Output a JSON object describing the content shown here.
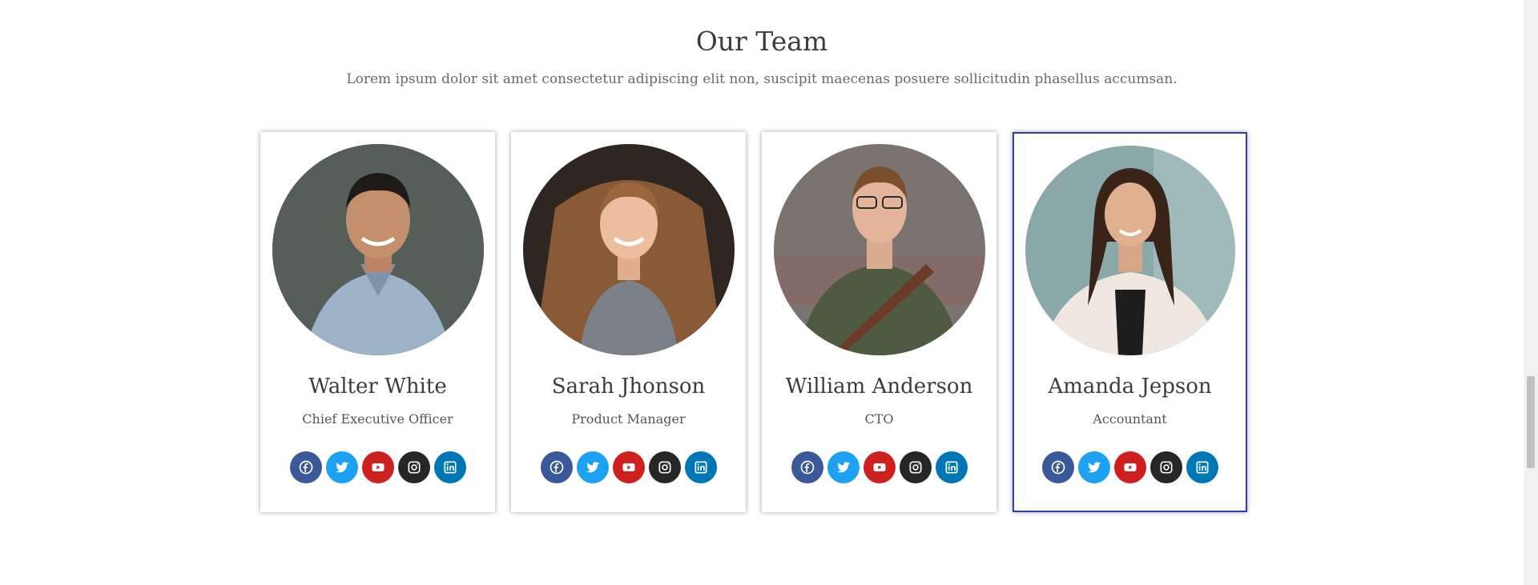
{
  "section": {
    "title": "Our Team",
    "subtitle": "Lorem ipsum dolor sit amet consectetur adipiscing elit non, suscipit maecenas posuere sollicitudin phasellus accumsan."
  },
  "team": [
    {
      "name": "Walter White",
      "role": "Chief Executive Officer",
      "active": false
    },
    {
      "name": "Sarah Jhonson",
      "role": "Product Manager",
      "active": false
    },
    {
      "name": "William Anderson",
      "role": "CTO",
      "active": false
    },
    {
      "name": "Amanda Jepson",
      "role": "Accountant",
      "active": true
    }
  ],
  "social_icons": [
    {
      "icon": "facebook-icon",
      "color": "#3b5998"
    },
    {
      "icon": "twitter-icon",
      "color": "#1da1f2"
    },
    {
      "icon": "youtube-icon",
      "color": "#cd201f"
    },
    {
      "icon": "instagram-icon",
      "color": "#262626"
    },
    {
      "icon": "linkedin-icon",
      "color": "#0077b5"
    }
  ],
  "colors": {
    "active_border": "#2f3fa8",
    "heading": "#3d3d3d",
    "text": "#6a6a6a"
  }
}
